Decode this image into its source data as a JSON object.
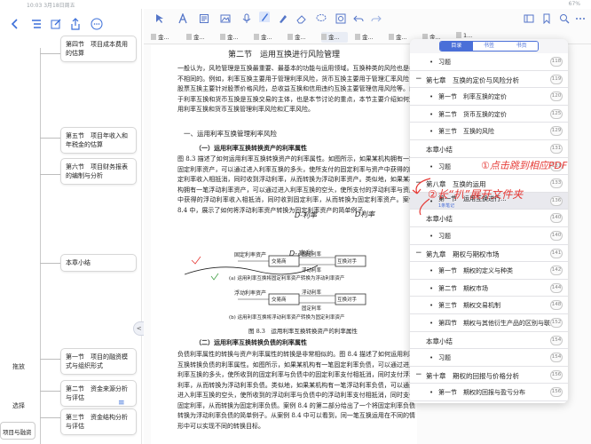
{
  "status": {
    "time": "10:03  3月18日周五",
    "right": "67%"
  },
  "mindmap": {
    "nodes": [
      {
        "text": "第四节　项目成本费用的估算"
      },
      {
        "text": "第五节　项目年收入和年税金的估算"
      },
      {
        "text": "第六节　项目财务报表的编制与分析"
      },
      {
        "text": "本章小结"
      },
      {
        "text": "第一节　项目的融资模式与组织形式"
      },
      {
        "text": "第二节　资金来源分析与评估"
      },
      {
        "text": "第三节　资金结构分析与评估"
      }
    ],
    "side_labels": {
      "expand": "拖放",
      "select": "选择"
    },
    "bottom_node": "项目与融资",
    "collapse_handle": "< · >"
  },
  "tabs": [
    "金...",
    "金...",
    "金...",
    "金...",
    "金...",
    "金...",
    "金...",
    "金...",
    "金...",
    "1..."
  ],
  "page": {
    "title": "第二节　运用互换进行风险管理",
    "intro": "一般认为，风险管理是互换最重要、最基本的功能与运用领域。互换种类的风险也是各不相同的。例如，利率互换主要用于管理利率风险，货币互换主要用于管理汇率风险，股票互换主要针对股票价格风险，总收益互换和信用违约互换主要管理信用风险等。由于利率互换和货币互换是互换交易的主体，也是本节讨论的重点，本节主要介绍如何运用利率互换和货币互换管理利率风险和汇率风险。",
    "h2": "一、运用利率互换管理利率风险",
    "h3a": "（一）运用利率互换转换资产的利率属性",
    "para_a": "图 8.3 描述了如何运用利率互换转换资产的利率属性。如图所示，如果某机构拥有一笔固定利率资产，可以通过进入利率互换的多头，使所支付的固定利率与资产中获得的固定利率收入相抵消，同时收到浮动利率，从而转换为浮动利率资产。类似地，如果某机构拥有一笔浮动利率资产，可以通过进入利率互换的空头，使所支付的浮动利率与资产中获得的浮动利率收入相抵消，同时收到固定利率，从而转换为固定利率资产。案例 8.4 中，展示了如何将浮动利率资产转换为固定利率资产的简单例子。",
    "figure": {
      "top_left": "固定利率资产",
      "top_mid": "交易商",
      "top_right1": "固定利率",
      "top_right2": "浮动利率",
      "top_end": "互换对手",
      "mid_caption": "(a) 运用利率互换将固定利率资产转换为浮动利率资产",
      "bot_left": "浮动利率资产",
      "bot_mid": "交易商",
      "bot_right1": "浮动利率",
      "bot_right2": "固定利率",
      "bot_end": "互换对手",
      "bot_caption": "(b) 运用利率互换将浮动利率资产转换为固定利率资产",
      "caption": "图 8.3　运用利率互换转换资产的利率属性"
    },
    "h3b": "（二）运用利率互换转换负债的利率属性",
    "para_b": "负债利率属性的转换与资产利率属性的转换是非常相似的。图 8.4 描述了如何运用利率互换转换负债的利率属性。如图所示，如果某机构有一笔固定利率负债，可以通过进入利率互换的多头，使所收到的固定利率与负债中的固定利率支付相抵消，同时支付浮动利率，从而转换为浮动利率负债。类似地，如果某机构有一笔浮动利率负债，可以通过进入利率互换的空头，使所收到的浮动利率与负债中的浮动利率支付相抵消，同时支付固定利率，从而转换为固定利率负债。案例 8.4 的第二部分给出了一个将固定利率负债转换为浮动利率负债的简单例子。从案例 8.4 中可以看到，同一笔互换运用在不同的情形中可以实现不同的转换目标。"
  },
  "handwriting": {
    "note1": "①点击跳到相应PDF",
    "note2": "②长“扒”展开文件夹",
    "d1": "D-利率",
    "d2": "D-高利",
    "d3": "D利率"
  },
  "toc": {
    "segments": [
      "目录",
      "书签",
      "书页"
    ],
    "rows": [
      {
        "kind": "section",
        "label": "习题",
        "page": "118"
      },
      {
        "kind": "chapter",
        "label": "第七章　互换的定价与风险分析",
        "page": "119",
        "ctl": "−"
      },
      {
        "kind": "section",
        "label": "第一节　利率互换的定价",
        "page": "120"
      },
      {
        "kind": "section",
        "label": "第二节　货币互换的定价",
        "page": "125"
      },
      {
        "kind": "section",
        "label": "第三节　互换的风险",
        "page": "129"
      },
      {
        "kind": "chapter",
        "label": "本章小结",
        "page": "131",
        "ctl": ""
      },
      {
        "kind": "section",
        "label": "习题",
        "page": "131"
      },
      {
        "kind": "chapter",
        "label": "第八章　互换的运用",
        "page": "133",
        "ctl": "−"
      },
      {
        "kind": "section-sel",
        "label": "第一节　运用互换进行...",
        "page": "136",
        "note": "1条笔记"
      },
      {
        "kind": "chapter",
        "label": "本章小结",
        "page": "140",
        "ctl": ""
      },
      {
        "kind": "section",
        "label": "习题",
        "page": "140"
      },
      {
        "kind": "chapter",
        "label": "第九章　期权与期权市场",
        "page": "141",
        "ctl": "−"
      },
      {
        "kind": "section",
        "label": "第一节　期权的定义与种类",
        "page": "142"
      },
      {
        "kind": "section",
        "label": "第二节　期权市场",
        "page": "144"
      },
      {
        "kind": "section",
        "label": "第三节　期权交易机制",
        "page": "148"
      },
      {
        "kind": "section",
        "label": "第四节　期权与其他衍生产品的区别与联系",
        "page": "152"
      },
      {
        "kind": "chapter",
        "label": "本章小结",
        "page": "154",
        "ctl": ""
      },
      {
        "kind": "section",
        "label": "习题",
        "page": "154"
      },
      {
        "kind": "chapter",
        "label": "第十章　期权的回报与价格分析",
        "page": "156",
        "ctl": "−"
      },
      {
        "kind": "section",
        "label": "第一节　期权的回报与盈亏分布",
        "page": "156"
      },
      {
        "kind": "section",
        "label": "第二节　期权价格的特性",
        "page": "172"
      }
    ]
  }
}
